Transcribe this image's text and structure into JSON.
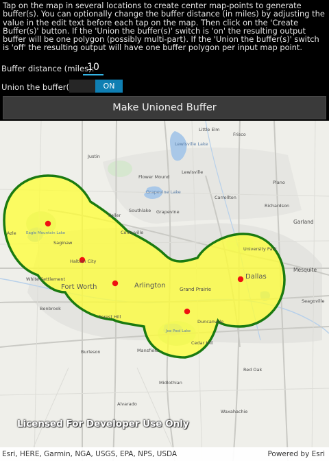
{
  "instructions": "Tap on the map in several locations to create center map-points to generate buffer(s). You can optionally change the buffer distance (in miles) by adjusting the value in the edit text before each tap on the map. Then click on the 'Create Buffer(s)' button. If the 'Union the buffer(s)' switch is 'on' the resulting output buffer will be one polygon (possibly multi-part). If the 'Union the buffer(s)' switch is 'off' the resulting output will have one buffer polygon per input map point.",
  "buffer_distance": {
    "label": "Buffer distance (miles):",
    "value": "10"
  },
  "union": {
    "label": "Union the buffer(s):",
    "state": "ON"
  },
  "action_button": "Make Unioned Buffer",
  "map": {
    "watermark": "Licensed For Developer Use Only",
    "attribution": "Esri, HERE, Garmin, NGA, USGS, EPA, NPS, USDA",
    "powered_by": "Powered by Esri",
    "buffer_fill": "#ffff33",
    "buffer_outline": "#1a7a10",
    "point_color": "#ee1111",
    "labels": {
      "little_elm": "Little Elm",
      "frisco": "Frisco",
      "lewisville_lake": "Lewisville Lake",
      "justin": "Justin",
      "lewisville": "Lewisville",
      "flower_mound": "Flower Mound",
      "plano": "Plano",
      "grapevine_lake": "Grapevine Lake",
      "southlake": "Southlake",
      "grapevine": "Grapevine",
      "carrollton": "Carrollton",
      "richardson": "Richardson",
      "garland": "Garland",
      "keller": "Keller",
      "colleyville": "Colleyville",
      "eagle_mountain_lake": "Eagle Mountain Lake",
      "saginaw": "Saginaw",
      "azle": "Azle",
      "university_park": "University Park",
      "haltom_city": "Haltom City",
      "white_settlement": "White Settlement",
      "fort_worth": "Fort Worth",
      "arlington": "Arlington",
      "grand_prairie": "Grand Prairie",
      "dallas": "Dallas",
      "mesquite": "Mesquite",
      "benbrook": "Benbrook",
      "forest_hill": "Forest Hill",
      "duncanville": "Duncanville",
      "seagoville": "Seagoville",
      "joe_pool_lake": "Joe Pool Lake",
      "cedar_hill": "Cedar Hill",
      "burleson": "Burleson",
      "mansfield": "Mansfield",
      "red_oak": "Red Oak",
      "midlothian": "Midlothian",
      "alvarado": "Alvarado",
      "waxahachie": "Waxahachie"
    }
  }
}
